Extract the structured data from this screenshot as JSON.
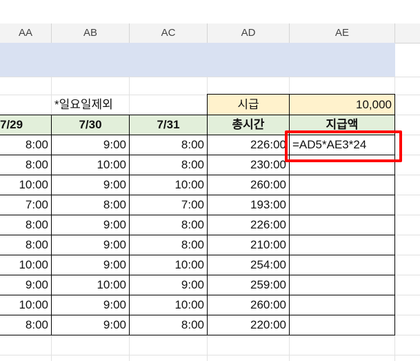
{
  "columns": [
    "AA",
    "AB",
    "AC",
    "AD",
    "AE"
  ],
  "note": "*일요일제외",
  "wage_label": "시급",
  "wage_value": "10,000",
  "headers": {
    "d729": "7/29",
    "d730": "7/30",
    "d731": "7/31",
    "total": "총시간",
    "pay": "지급액"
  },
  "formula": "=AD5*AE3*24",
  "rows": [
    [
      "8:00",
      "9:00",
      "8:00",
      "226:00"
    ],
    [
      "8:00",
      "10:00",
      "8:00",
      "230:00"
    ],
    [
      "10:00",
      "9:00",
      "10:00",
      "260:00"
    ],
    [
      "7:00",
      "8:00",
      "7:00",
      "193:00"
    ],
    [
      "8:00",
      "9:00",
      "8:00",
      "226:00"
    ],
    [
      "8:00",
      "9:00",
      "8:00",
      "210:00"
    ],
    [
      "10:00",
      "9:00",
      "10:00",
      "254:00"
    ],
    [
      "9:00",
      "10:00",
      "9:00",
      "259:00"
    ],
    [
      "10:00",
      "9:00",
      "10:00",
      "260:00"
    ],
    [
      "8:00",
      "9:00",
      "8:00",
      "220:00"
    ]
  ],
  "colors": {
    "header_band": "#d9e1f2",
    "header_green": "#e2efda",
    "header_peach": "#fff2cc",
    "highlight": "#ff0000"
  }
}
